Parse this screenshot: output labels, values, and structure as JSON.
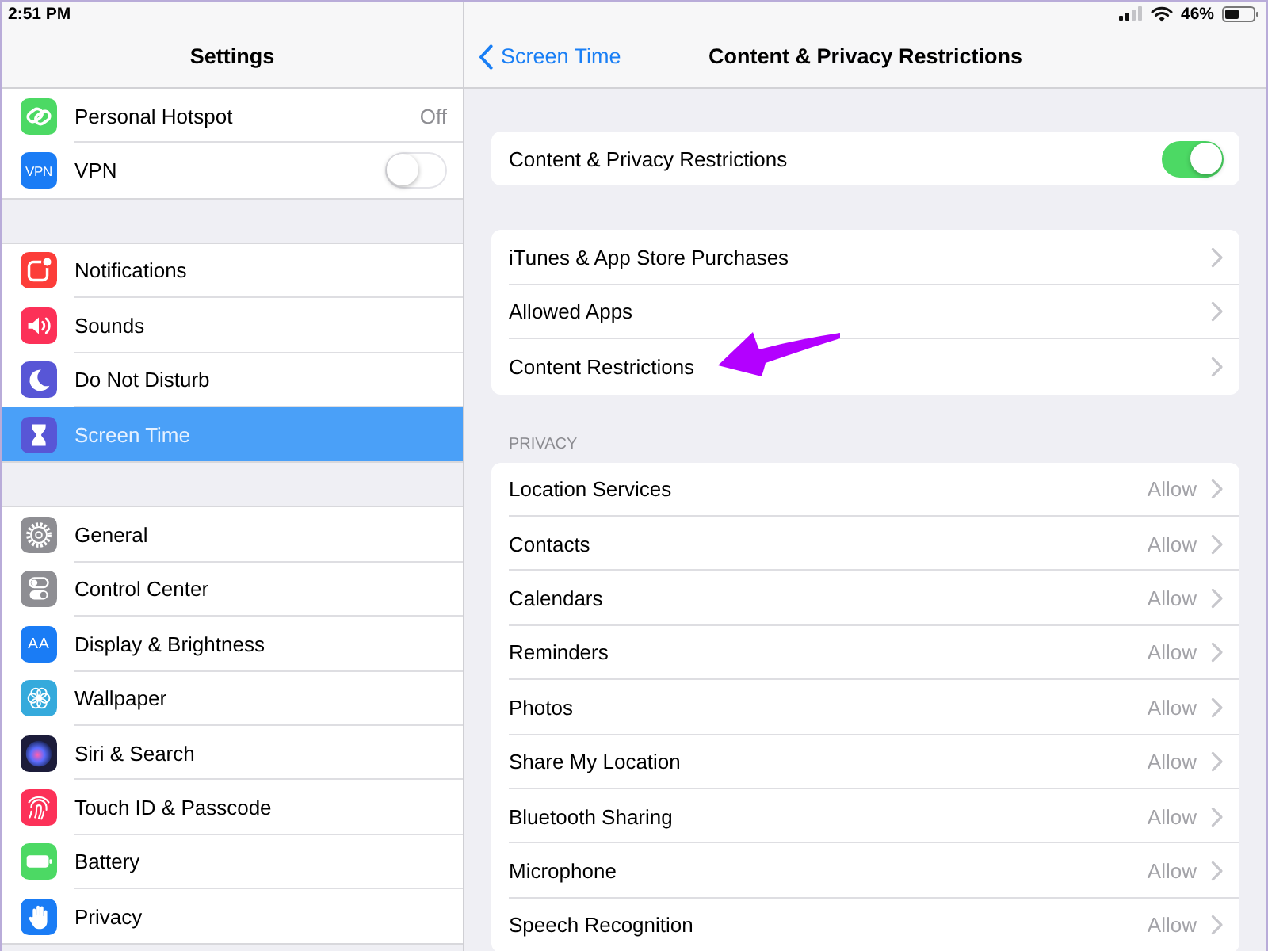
{
  "status_bar": {
    "time": "2:51 PM",
    "battery": "46%"
  },
  "sidebar": {
    "title": "Settings",
    "groups": [
      {
        "items": [
          {
            "label": "Personal Hotspot",
            "kind": "link",
            "value": "Off",
            "selected": false
          },
          {
            "label": "VPN",
            "kind": "toggle",
            "on": false,
            "icon_text": "VPN",
            "selected": false
          }
        ]
      },
      {
        "items": [
          {
            "label": "Notifications",
            "kind": "link",
            "selected": false
          },
          {
            "label": "Sounds",
            "kind": "link",
            "selected": false
          },
          {
            "label": "Do Not Disturb",
            "kind": "link",
            "selected": false
          },
          {
            "label": "Screen Time",
            "kind": "link",
            "selected": true
          }
        ]
      },
      {
        "items": [
          {
            "label": "General",
            "kind": "link",
            "selected": false
          },
          {
            "label": "Control Center",
            "kind": "link",
            "selected": false
          },
          {
            "label": "Display & Brightness",
            "kind": "link",
            "icon_text": "AA",
            "selected": false
          },
          {
            "label": "Wallpaper",
            "kind": "link",
            "selected": false
          },
          {
            "label": "Siri & Search",
            "kind": "link",
            "selected": false
          },
          {
            "label": "Touch ID & Passcode",
            "kind": "link",
            "selected": false
          },
          {
            "label": "Battery",
            "kind": "link",
            "selected": false
          },
          {
            "label": "Privacy",
            "kind": "link",
            "selected": false
          }
        ]
      }
    ]
  },
  "detail": {
    "back": "Screen Time",
    "title": "Content & Privacy Restrictions",
    "groups": [
      {
        "rows": [
          {
            "label": "Content & Privacy Restrictions",
            "kind": "toggle",
            "on": true,
            "pointed_at": false
          }
        ]
      },
      {
        "rows": [
          {
            "label": "iTunes & App Store Purchases",
            "kind": "link",
            "pointed_at": false
          },
          {
            "label": "Allowed Apps",
            "kind": "link",
            "pointed_at": false
          },
          {
            "label": "Content Restrictions",
            "kind": "link",
            "pointed_at": true
          }
        ]
      },
      {
        "header": "PRIVACY",
        "rows": [
          {
            "label": "Location Services",
            "kind": "link",
            "value": "Allow",
            "pointed_at": false
          },
          {
            "label": "Contacts",
            "kind": "link",
            "value": "Allow",
            "pointed_at": false
          },
          {
            "label": "Calendars",
            "kind": "link",
            "value": "Allow",
            "pointed_at": false
          },
          {
            "label": "Reminders",
            "kind": "link",
            "value": "Allow",
            "pointed_at": false
          },
          {
            "label": "Photos",
            "kind": "link",
            "value": "Allow",
            "pointed_at": false
          },
          {
            "label": "Share My Location",
            "kind": "link",
            "value": "Allow",
            "pointed_at": false
          },
          {
            "label": "Bluetooth Sharing",
            "kind": "link",
            "value": "Allow",
            "pointed_at": false
          },
          {
            "label": "Microphone",
            "kind": "link",
            "value": "Allow",
            "pointed_at": false
          },
          {
            "label": "Speech Recognition",
            "kind": "link",
            "value": "Allow",
            "pointed_at": false
          }
        ]
      }
    ]
  }
}
